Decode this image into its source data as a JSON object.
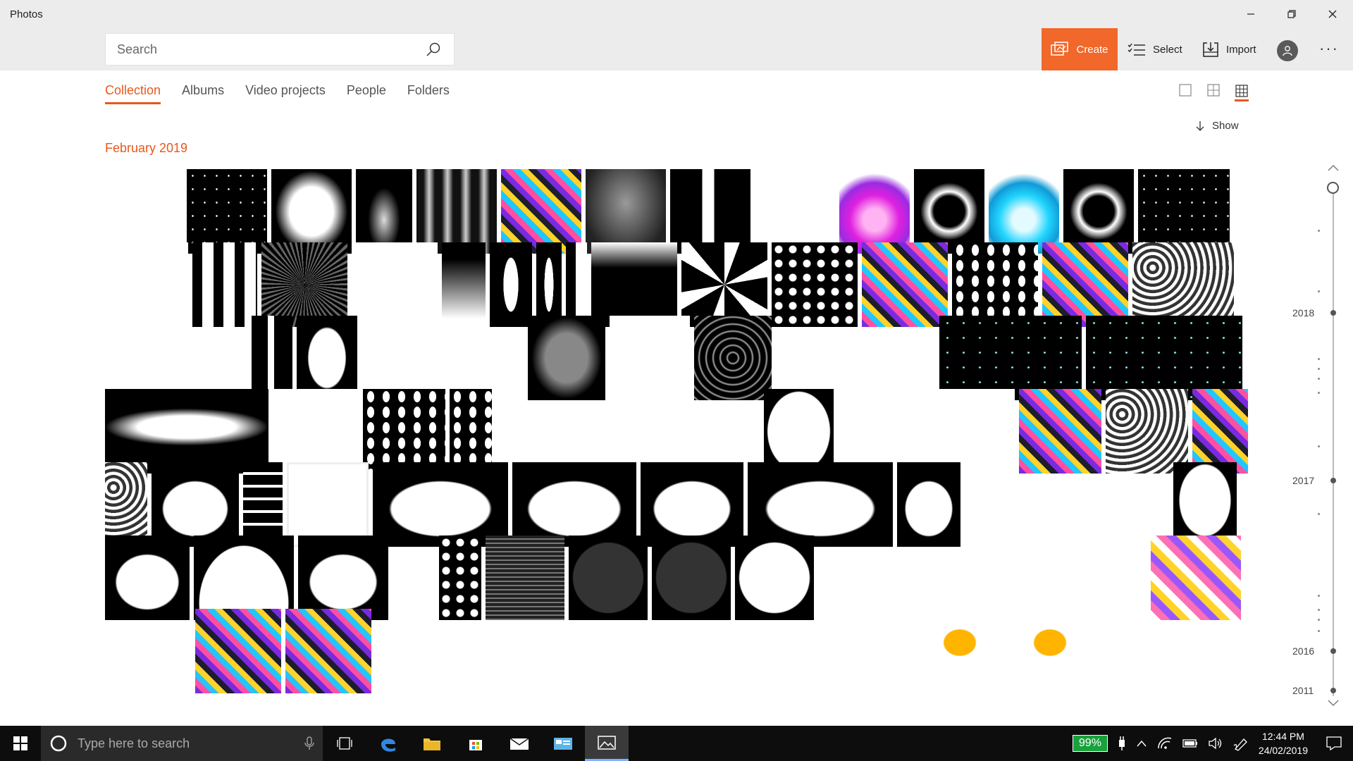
{
  "app": {
    "title": "Photos"
  },
  "search": {
    "placeholder": "Search"
  },
  "toolbar": {
    "create": "Create",
    "select": "Select",
    "import": "Import"
  },
  "tabs": [
    "Collection",
    "Albums",
    "Video projects",
    "People",
    "Folders"
  ],
  "active_tab": "Collection",
  "show_label": "Show",
  "section": "February 2019",
  "timeline": {
    "years": [
      "2018",
      "2017",
      "2016",
      "2011"
    ]
  },
  "taskbar": {
    "search_placeholder": "Type here to search",
    "battery": "99%",
    "time": "12:44 PM",
    "date": "24/02/2019"
  },
  "colors": {
    "accent": "#e8581b",
    "create": "#f2672a"
  },
  "thumbnail_rows": [
    [
      {
        "w": 110,
        "s": "sprites"
      },
      {
        "w": 114,
        "s": "stars"
      },
      {
        "w": 114,
        "s": "glow-square"
      },
      {
        "w": 80,
        "s": "drop"
      },
      {
        "w": 114,
        "s": "waves"
      },
      {
        "w": 114,
        "s": "colorful"
      },
      {
        "w": 114,
        "s": "cloud"
      },
      {
        "w": 114,
        "s": "bw-shapes"
      },
      {
        "w": 114,
        "s": "gears"
      },
      {
        "w": 100,
        "s": "pink-flame"
      },
      {
        "w": 100,
        "s": "ring"
      },
      {
        "w": 100,
        "s": "cyan-flame"
      },
      {
        "w": 100,
        "s": "ring"
      },
      {
        "w": 130,
        "s": "stars"
      }
    ],
    [
      {
        "w": 118,
        "s": "white"
      },
      {
        "w": 92,
        "s": "strips"
      },
      {
        "w": 122,
        "s": "burst"
      },
      {
        "w": 122,
        "s": "white"
      },
      {
        "w": 62,
        "s": "gradient-v"
      },
      {
        "w": 60,
        "s": "torn"
      },
      {
        "w": 36,
        "s": "torn"
      },
      {
        "w": 30,
        "s": "strips"
      },
      {
        "w": 122,
        "s": "gradient-h"
      },
      {
        "w": 122,
        "s": "swirl"
      },
      {
        "w": 122,
        "s": "dots"
      },
      {
        "w": 122,
        "s": "colorful"
      },
      {
        "w": 122,
        "s": "leaves"
      },
      {
        "w": 122,
        "s": "colorful"
      },
      {
        "w": 144,
        "s": "sprites-light"
      }
    ],
    [
      {
        "w": 202,
        "s": "camo"
      },
      {
        "w": 58,
        "s": "bw-shapes"
      },
      {
        "w": 86,
        "s": "blob"
      },
      {
        "w": 114,
        "s": "white"
      },
      {
        "w": 110,
        "s": "rainbow"
      },
      {
        "w": 110,
        "s": "soft-square"
      },
      {
        "w": 114,
        "s": "white"
      },
      {
        "w": 110,
        "s": "vortex"
      },
      {
        "w": 110,
        "s": "dots-color"
      },
      {
        "w": 110,
        "s": "dots-color"
      },
      {
        "w": 202,
        "s": "sparkle"
      },
      {
        "w": 222,
        "s": "sparkle"
      }
    ],
    [
      {
        "w": 234,
        "s": "smoke"
      },
      {
        "w": 124,
        "s": "white"
      },
      {
        "w": 118,
        "s": "leaves"
      },
      {
        "w": 60,
        "s": "leaves"
      },
      {
        "w": 124,
        "s": "white-corner"
      },
      {
        "w": 118,
        "s": "gears"
      },
      {
        "w": 124,
        "s": "white-corner"
      },
      {
        "w": 100,
        "s": "oval"
      },
      {
        "w": 124,
        "s": "white"
      },
      {
        "w": 124,
        "s": "white"
      },
      {
        "w": 118,
        "s": "colorful"
      },
      {
        "w": 118,
        "s": "sprites-light"
      },
      {
        "w": 80,
        "s": "colorful"
      }
    ],
    [
      {
        "w": 60,
        "s": "sprites-light"
      },
      {
        "w": 124,
        "s": "silhouette"
      },
      {
        "w": 56,
        "s": "ladder"
      },
      {
        "w": 116,
        "s": "white-frame"
      },
      {
        "w": 192,
        "s": "silhouette"
      },
      {
        "w": 176,
        "s": "silhouette"
      },
      {
        "w": 146,
        "s": "silhouette"
      },
      {
        "w": 206,
        "s": "silhouette"
      },
      {
        "w": 90,
        "s": "silhouette"
      },
      {
        "w": 142,
        "s": "signs"
      },
      {
        "w": 142,
        "s": "signs"
      },
      {
        "w": 90,
        "s": "tree"
      }
    ],
    [
      {
        "w": 120,
        "s": "silhouette"
      },
      {
        "w": 142,
        "s": "dome"
      },
      {
        "w": 128,
        "s": "silhouette"
      },
      {
        "w": 60,
        "s": "orbs"
      },
      {
        "w": 60,
        "s": "dots"
      },
      {
        "w": 112,
        "s": "text"
      },
      {
        "w": 112,
        "s": "dark-disc"
      },
      {
        "w": 112,
        "s": "dark-disc"
      },
      {
        "w": 112,
        "s": "white-disc"
      },
      {
        "w": 112,
        "s": "play"
      },
      {
        "w": 112,
        "s": "pause"
      },
      {
        "w": 112,
        "s": "close"
      },
      {
        "w": 112,
        "s": "crescent"
      },
      {
        "w": 128,
        "s": "colorful-light"
      }
    ],
    [
      {
        "w": 122,
        "s": "sprites"
      },
      {
        "w": 122,
        "s": "colorful"
      },
      {
        "w": 122,
        "s": "colorful"
      },
      {
        "w": 122,
        "s": "sprites"
      },
      {
        "w": 122,
        "s": "sprites"
      },
      {
        "w": 122,
        "s": "coins"
      },
      {
        "w": 122,
        "s": "coins"
      },
      {
        "w": 122,
        "s": "sprites"
      },
      {
        "w": 122,
        "s": "sprites"
      },
      {
        "w": 122,
        "s": "crown"
      },
      {
        "w": 122,
        "s": "crown"
      }
    ]
  ]
}
